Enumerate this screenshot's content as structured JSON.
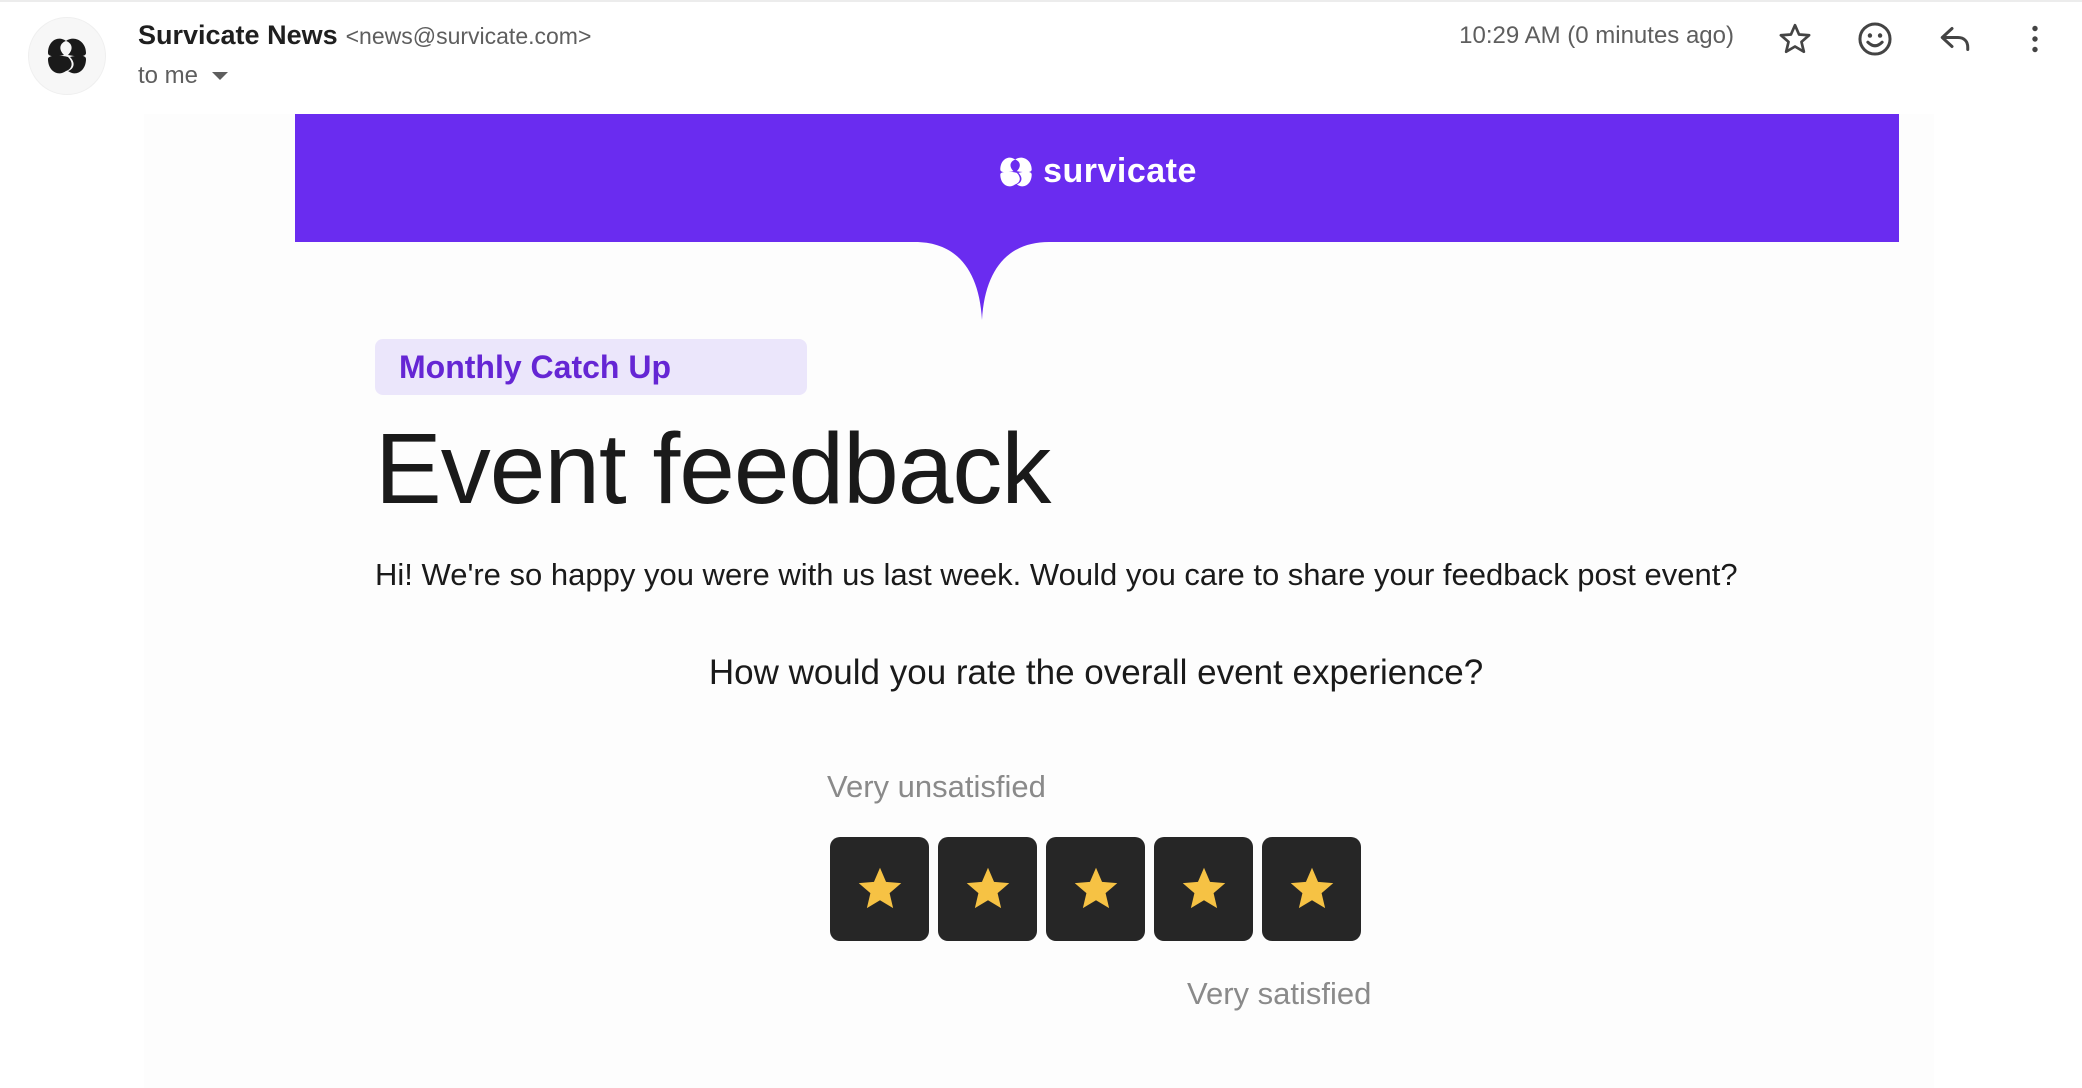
{
  "header": {
    "sender_name": "Survicate News",
    "sender_email": "<news@survicate.com>",
    "recipient": "to me",
    "timestamp": "10:29 AM (0 minutes ago)",
    "icons": [
      "star-icon",
      "emoji-icon",
      "reply-icon",
      "more-vert-icon"
    ]
  },
  "email": {
    "brand_name": "survicate",
    "tag": "Monthly Catch Up",
    "headline": "Event feedback",
    "intro": "Hi! We're so happy you were with us last week. Would you care to share your feedback post event?",
    "question": "How would you rate the overall event experience?",
    "label_low": "Very unsatisfied",
    "label_high": "Very satisfied",
    "rating_scale": 5
  },
  "colors": {
    "brand_purple": "#6a2cf0",
    "tag_bg": "#ebe6fb",
    "tag_text": "#6526d4",
    "star_button_bg": "#262626",
    "star": "#f6c244"
  }
}
